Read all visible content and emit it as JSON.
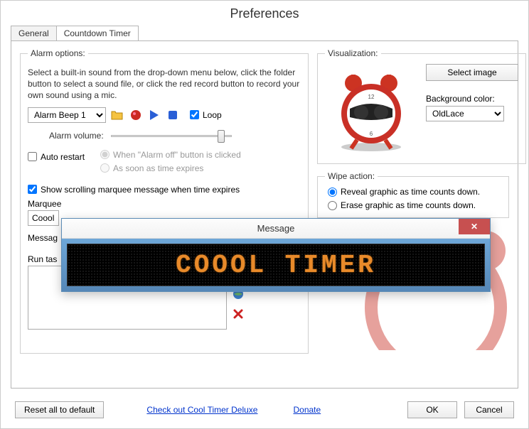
{
  "title": "Preferences",
  "tabs": {
    "general": "General",
    "countdown": "Countdown Timer"
  },
  "alarm": {
    "legend": "Alarm options:",
    "instructions": "Select a built-in sound from the drop-down menu below, click the folder button to select a sound file, or click the red record button to record your own sound using a mic.",
    "sound_select": "Alarm Beep 1",
    "loop_label": "Loop",
    "loop_checked": true,
    "volume_label": "Alarm volume:",
    "auto_restart_label": "Auto restart",
    "auto_restart_checked": false,
    "radio_when_off": "When \"Alarm off\" button is clicked",
    "radio_expires": "As soon as time expires",
    "show_marquee_checked": true,
    "show_marquee_label": "Show scrolling marquee message when time expires",
    "marquee_legend_trunc": "Marquee",
    "marquee_text_value": "Coool T",
    "message_label_trunc": "Messag",
    "run_task_label_trunc": "Run tas"
  },
  "visualization": {
    "legend": "Visualization:",
    "select_image_btn": "Select image",
    "bg_color_label": "Background color:",
    "bg_color_value": "OldLace"
  },
  "wipe": {
    "legend": "Wipe action:",
    "reveal": "Reveal graphic as time counts down.",
    "erase": "Erase graphic as time counts down."
  },
  "footer": {
    "reset": "Reset all to default",
    "deluxe_link": "Check out Cool Timer Deluxe",
    "donate_link": "Donate",
    "ok": "OK",
    "cancel": "Cancel"
  },
  "modal": {
    "title": "Message",
    "marquee_text": "COOOL TIMER"
  },
  "icons": {
    "folder": "folder-icon",
    "record": "record-icon",
    "play": "play-icon",
    "stop": "stop-icon",
    "globe": "globe-icon",
    "delete": "delete-icon"
  }
}
